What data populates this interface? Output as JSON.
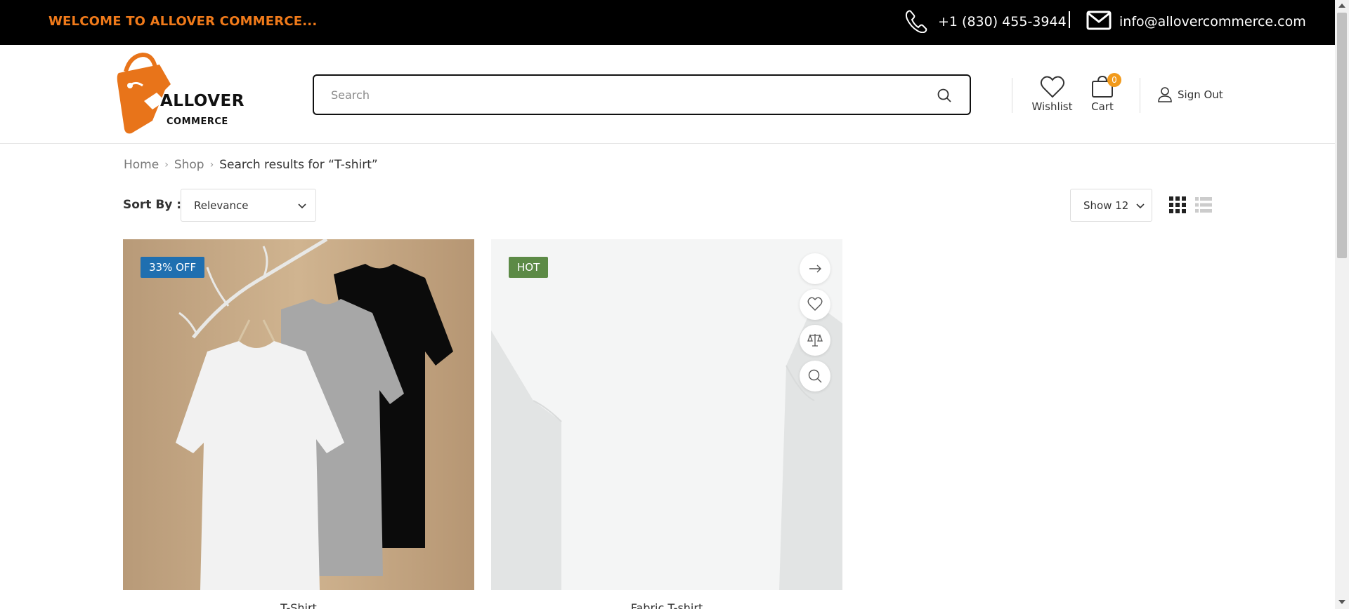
{
  "topbar": {
    "welcome": "WELCOME TO ALLOVER COMMERCE...",
    "phone": "+1 (830) 455-3944",
    "email": "info@allovercommerce.com"
  },
  "header": {
    "logo_line1": "ALLOVER",
    "logo_line2": "COMMERCE",
    "search_placeholder": "Search",
    "wishlist_label": "Wishlist",
    "cart_label": "Cart",
    "cart_count": "0",
    "signout_label": "Sign Out"
  },
  "breadcrumb": {
    "items": [
      "Home",
      "Shop"
    ],
    "current": "Search results for “T-shirt”"
  },
  "toolbar": {
    "sort_label": "Sort By :",
    "sort_value": "Relevance",
    "show_value": "Show 12"
  },
  "products": [
    {
      "name": "T-Shirt",
      "badge": "33% OFF"
    },
    {
      "name": "Fabric T-shirt",
      "badge": "HOT"
    }
  ],
  "colors": {
    "accent_orange": "#f07a1a",
    "badge_blue": "#1f6fb0",
    "badge_green": "#5c8a46"
  }
}
